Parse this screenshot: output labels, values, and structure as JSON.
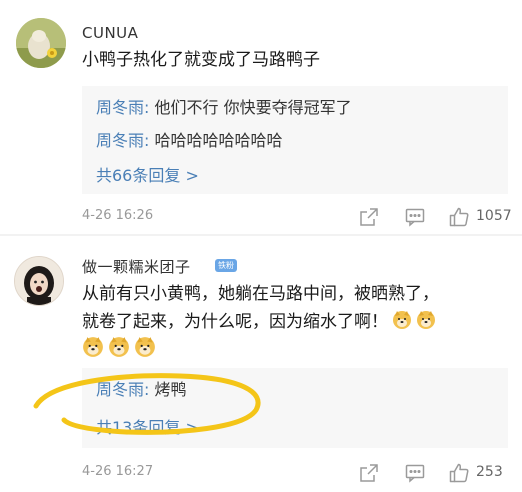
{
  "comments": [
    {
      "username": "CUNUA",
      "text": "小鸭子热化了就变成了马路鸭子",
      "replies": [
        {
          "author": "周冬雨:",
          "text": " 他们不行  你快要夺得冠军了"
        },
        {
          "author": "周冬雨:",
          "text": " 哈哈哈哈哈哈哈哈"
        }
      ],
      "more_replies": "共66条回复 >",
      "time": "4-26 16:26",
      "likes": "1057"
    },
    {
      "username": "做一颗糯米团子",
      "badge": "铁粉",
      "text_line1": "从前有只小黄鸭，她躺在马路中间，被晒熟了，",
      "text_line2": "就卷了起来，为什么呢，因为缩水了啊！",
      "replies": [
        {
          "author": "周冬雨:",
          "text": " 烤鸭"
        }
      ],
      "more_replies": "共13条回复 >",
      "time": "4-26 16:27",
      "likes": "253"
    }
  ],
  "icons": {
    "share": "share-icon",
    "reply": "comment-icon",
    "like": "thumbs-up-icon",
    "emoji": "doge-emoji"
  },
  "colors": {
    "link": "#4a7fb6",
    "reply_bg": "#f7f7f7",
    "annotation": "#f4c518"
  }
}
